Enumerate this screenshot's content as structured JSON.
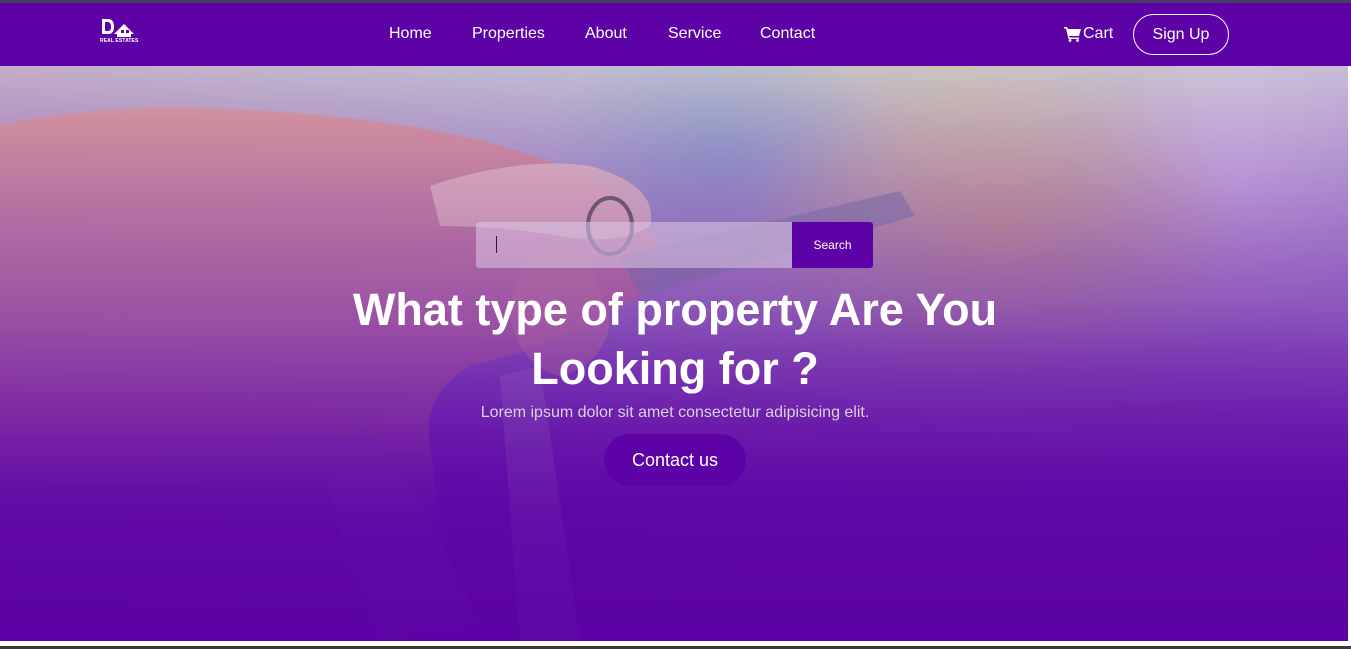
{
  "logo": {
    "caption": "REAL ESTATES",
    "icon": "house-logo-icon"
  },
  "nav": {
    "links": [
      {
        "label": "Home"
      },
      {
        "label": "Properties"
      },
      {
        "label": "About"
      },
      {
        "label": "Service"
      },
      {
        "label": "Contact"
      }
    ],
    "cart_label": "Cart",
    "cart_icon": "cart-icon",
    "signup_label": "Sign Up"
  },
  "search": {
    "value": "",
    "button_label": "Search"
  },
  "hero": {
    "headline": "What type of property Are You Looking for ?",
    "subtext": "Lorem ipsum dolor sit amet consectetur adipisicing elit.",
    "cta_label": "Contact us"
  },
  "colors": {
    "brand": "#5c02a6",
    "text": "#ffffff"
  }
}
